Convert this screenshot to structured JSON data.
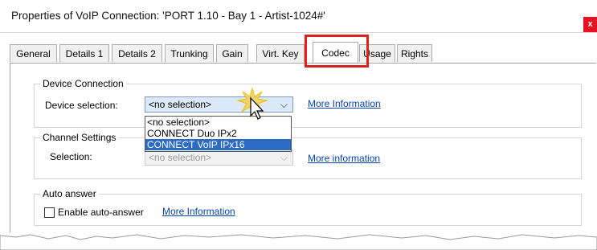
{
  "window": {
    "title": "Properties of VoIP Connection: 'PORT 1.10 - Bay 1 - Artist-1024#'",
    "close_label": "x"
  },
  "tabs": [
    {
      "label": "General"
    },
    {
      "label": "Details 1"
    },
    {
      "label": "Details 2"
    },
    {
      "label": "Trunking"
    },
    {
      "label": "Gain"
    },
    {
      "label": "Virt. Key"
    },
    {
      "label": "Codec",
      "active": true,
      "highlighted": true
    },
    {
      "label": "Usage"
    },
    {
      "label": "Rights"
    }
  ],
  "device_connection": {
    "title": "Device Connection",
    "label": "Device selection:",
    "value": "<no selection>",
    "link": "More Information",
    "dropdown_open": true,
    "options": [
      "<no selection>",
      "CONNECT Duo IPx2",
      "CONNECT VoIP IPx16"
    ],
    "hovered_option": "CONNECT VoIP IPx16"
  },
  "channel_settings": {
    "title": "Channel Settings",
    "label": "Selection:",
    "value": "<no selection>",
    "disabled": true,
    "link": "More information"
  },
  "auto_answer": {
    "title": "Auto answer",
    "checkbox_label": "Enable auto-answer",
    "checked": false,
    "link": "More Information"
  },
  "colors": {
    "highlight": "#e02020",
    "link": "#0645ad",
    "selection": "#2b6ac5",
    "close": "#e81123"
  }
}
